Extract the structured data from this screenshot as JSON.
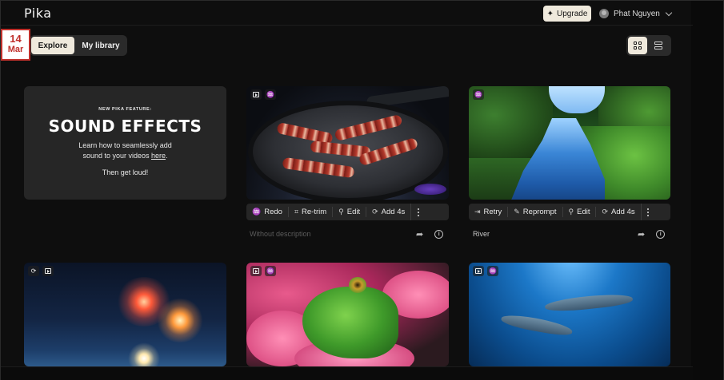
{
  "header": {
    "logo": "Pika",
    "upgrade_label": "Upgrade",
    "user_name": "Phat Nguyen"
  },
  "date_badge": {
    "day": "14",
    "month": "Mar"
  },
  "tabs": [
    {
      "label": "Explore",
      "active": true
    },
    {
      "label": "My library",
      "active": false
    }
  ],
  "view_toggle": {
    "selected": "grid"
  },
  "promo": {
    "kicker": "NEW PIKA FEATURE:",
    "headline": "SOUND EFFECTS",
    "body_line1": "Learn how to seamlessly add",
    "body_line2_prefix": "sound to your videos ",
    "body_link": "here",
    "body_line2_suffix": ".",
    "cta": "Then get loud!"
  },
  "videos": [
    {
      "actions": [
        "Redo",
        "Re-trim",
        "Edit",
        "Add 4s"
      ],
      "caption": "Without description"
    },
    {
      "actions": [
        "Retry",
        "Reprompt",
        "Edit",
        "Add 4s"
      ],
      "caption": "River"
    }
  ],
  "icons": {
    "sparkle": "sparkle-icon",
    "share": "share-icon",
    "info": "info-icon",
    "more": "more-vertical-icon"
  },
  "colors": {
    "background": "#0e0e0e",
    "accent_cream": "#efe9dc",
    "card": "#262626",
    "badge_red": "#c0302b"
  }
}
